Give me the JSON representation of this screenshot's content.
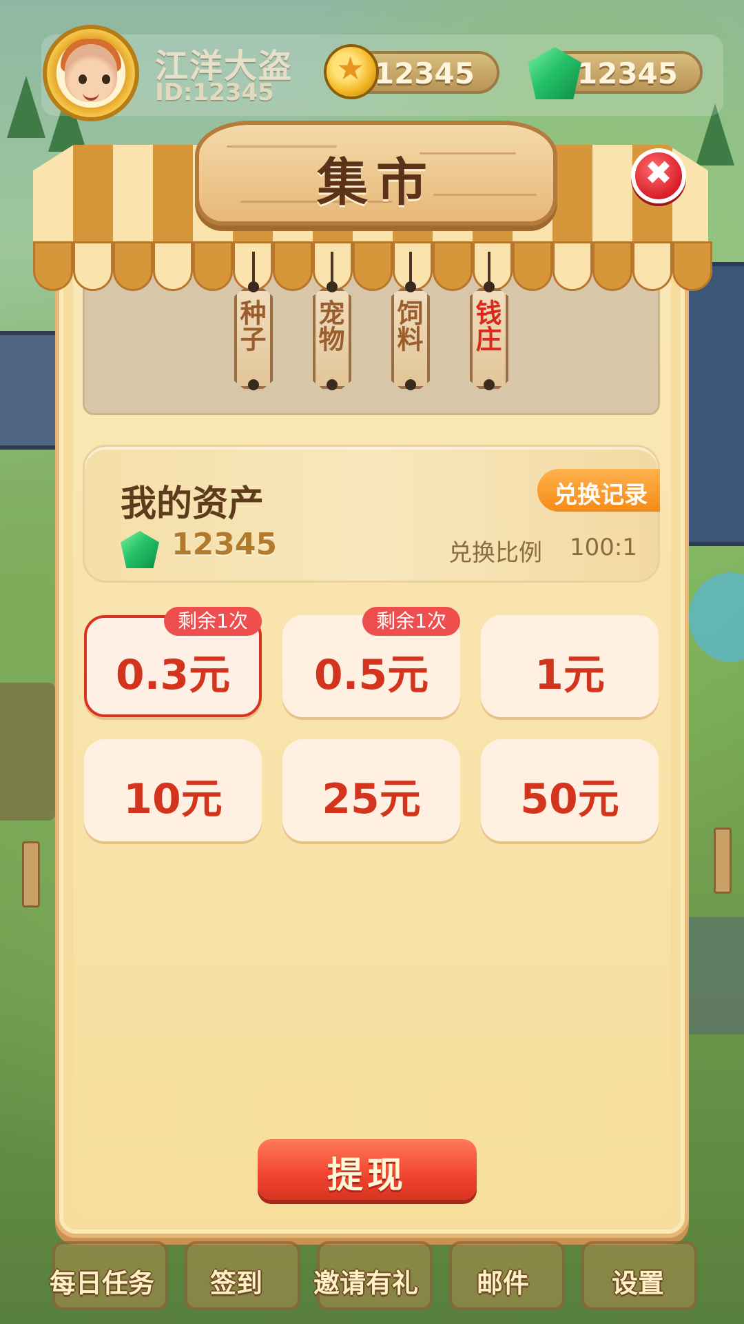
{
  "player": {
    "name": "江洋大盗",
    "id": "ID:12345"
  },
  "currency": {
    "coins": "12345",
    "gems": "12345"
  },
  "market": {
    "title": "集市",
    "tabs": [
      {
        "label": "种子",
        "active": false
      },
      {
        "label": "宠物",
        "active": false
      },
      {
        "label": "饲料",
        "active": false
      },
      {
        "label": "钱庄",
        "active": true
      }
    ],
    "assets": {
      "title": "我的资产",
      "record_button": "兑换记录",
      "gems": "12345",
      "ratio_label": "兑换比例",
      "ratio_value": "100:1"
    },
    "amounts": [
      {
        "label": "0.3元",
        "badge": "剩余1次",
        "selected": true
      },
      {
        "label": "0.5元",
        "badge": "剩余1次",
        "selected": false
      },
      {
        "label": "1元",
        "badge": "",
        "selected": false
      },
      {
        "label": "10元",
        "badge": "",
        "selected": false
      },
      {
        "label": "25元",
        "badge": "",
        "selected": false
      },
      {
        "label": "50元",
        "badge": "",
        "selected": false
      }
    ],
    "withdraw_button": "提现"
  },
  "bottom_nav": [
    "每日任务",
    "签到",
    "邀请有礼",
    "邮件",
    "设置"
  ],
  "colors": {
    "accent_red": "#d2341d",
    "badge_red": "#ee4e4e",
    "orange": "#f48b16",
    "panel": "#f6dc9d"
  },
  "icons": {
    "close": "close-icon",
    "coin": "coin-icon",
    "gem": "gem-icon"
  }
}
